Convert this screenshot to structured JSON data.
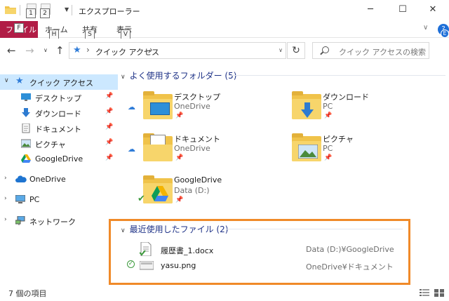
{
  "window": {
    "title": "エクスプローラー",
    "controls": {
      "minimize": "─",
      "maximize": "☐",
      "close": "✕"
    },
    "quick_access_keytips": [
      "1",
      "2"
    ]
  },
  "ribbon": {
    "file_tab": "ファイル",
    "file_keytip": "F",
    "tabs": [
      {
        "label": "ホーム",
        "keytip": "H"
      },
      {
        "label": "共有",
        "keytip": "S"
      },
      {
        "label": "表示",
        "keytip": "V"
      }
    ],
    "expand_chevron": "∨",
    "help_keytip": "E"
  },
  "address": {
    "breadcrumb": "クイック アクセス",
    "search_placeholder": "クイック アクセスの検索"
  },
  "sidebar": {
    "quick_access": "クイック アクセス",
    "pinned": [
      {
        "label": "デスクトップ",
        "icon": "desktop-icon"
      },
      {
        "label": "ダウンロード",
        "icon": "download-icon"
      },
      {
        "label": "ドキュメント",
        "icon": "documents-icon"
      },
      {
        "label": "ピクチャ",
        "icon": "pictures-icon"
      },
      {
        "label": "GoogleDrive",
        "icon": "google-drive-icon"
      }
    ],
    "roots": [
      {
        "label": "OneDrive",
        "icon": "onedrive-icon"
      },
      {
        "label": "PC",
        "icon": "pc-icon"
      },
      {
        "label": "ネットワーク",
        "icon": "network-icon"
      }
    ]
  },
  "main": {
    "frequent_header": "よく使用するフォルダー (5)",
    "folders": [
      {
        "name": "デスクトップ",
        "sub": "OneDrive",
        "cloud": true
      },
      {
        "name": "ダウンロード",
        "sub": "PC",
        "cloud": false
      },
      {
        "name": "ドキュメント",
        "sub": "OneDrive",
        "cloud": true
      },
      {
        "name": "ピクチャ",
        "sub": "PC",
        "cloud": false
      },
      {
        "name": "GoogleDrive",
        "sub": "Data (D:)",
        "cloud": false
      }
    ],
    "recent_header": "最近使用したファイル (2)",
    "recent_files": [
      {
        "name": "履歴書_1.docx",
        "location": "Data (D:)¥GoogleDrive",
        "status": ""
      },
      {
        "name": "yasu.png",
        "location": "OneDrive¥ドキュメント",
        "status": "✓"
      }
    ]
  },
  "status": {
    "item_count": "7 個の項目"
  },
  "colors": {
    "file_tab": "#b11d46",
    "selection": "#cce8ff",
    "group_header": "#1e3287",
    "highlight_box": "#f08a29"
  }
}
